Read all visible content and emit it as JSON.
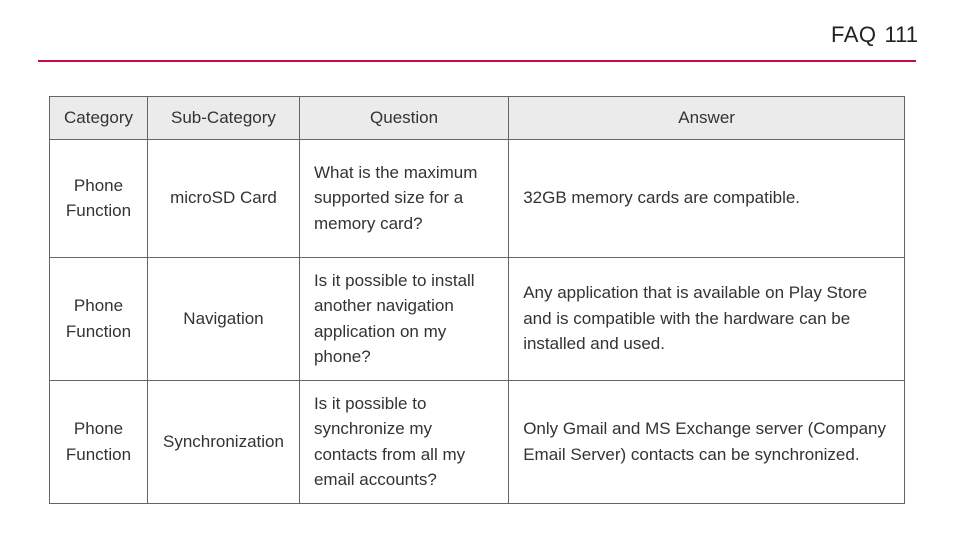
{
  "header": {
    "title": "FAQ",
    "page_number": "111"
  },
  "table": {
    "headers": {
      "category": "Category",
      "sub_category": "Sub-Category",
      "question": "Question",
      "answer": "Answer"
    },
    "rows": [
      {
        "category": "Phone Function",
        "sub_category": "microSD Card",
        "question": "What is the maximum supported size for a memory card?",
        "answer": "32GB memory cards are compatible."
      },
      {
        "category": "Phone Function",
        "sub_category": "Navigation",
        "question": "Is it possible to install another navigation application on my phone?",
        "answer": "Any application that is available on Play Store and is compatible with the hardware can be installed and used."
      },
      {
        "category": "Phone Function",
        "sub_category": "Synchronization",
        "question": "Is it possible to synchronize my contacts from all my email accounts?",
        "answer": "Only Gmail and MS Exchange server (Company Email Server) contacts can be synchronized."
      }
    ]
  }
}
